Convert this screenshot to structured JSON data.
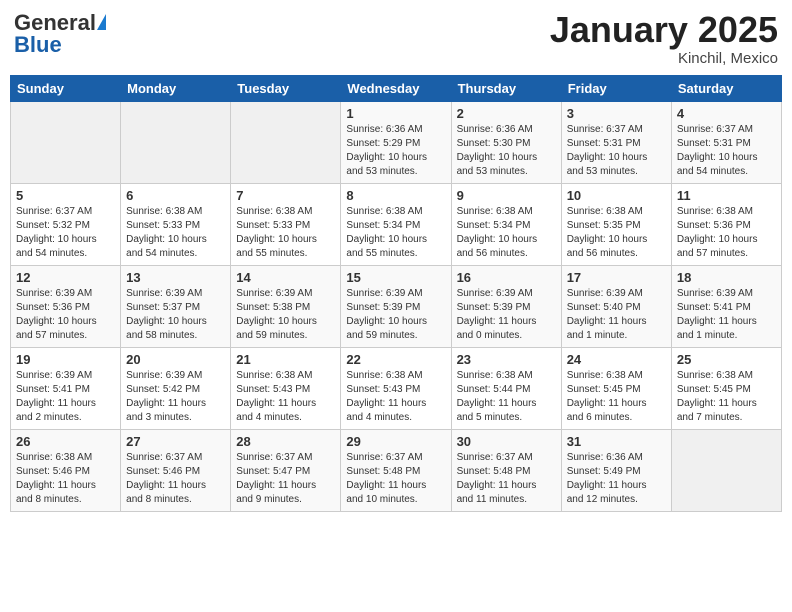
{
  "header": {
    "logo_general": "General",
    "logo_blue": "Blue",
    "month_year": "January 2025",
    "location": "Kinchil, Mexico"
  },
  "days_of_week": [
    "Sunday",
    "Monday",
    "Tuesday",
    "Wednesday",
    "Thursday",
    "Friday",
    "Saturday"
  ],
  "weeks": [
    [
      {
        "day": "",
        "info": ""
      },
      {
        "day": "",
        "info": ""
      },
      {
        "day": "",
        "info": ""
      },
      {
        "day": "1",
        "info": "Sunrise: 6:36 AM\nSunset: 5:29 PM\nDaylight: 10 hours\nand 53 minutes."
      },
      {
        "day": "2",
        "info": "Sunrise: 6:36 AM\nSunset: 5:30 PM\nDaylight: 10 hours\nand 53 minutes."
      },
      {
        "day": "3",
        "info": "Sunrise: 6:37 AM\nSunset: 5:31 PM\nDaylight: 10 hours\nand 53 minutes."
      },
      {
        "day": "4",
        "info": "Sunrise: 6:37 AM\nSunset: 5:31 PM\nDaylight: 10 hours\nand 54 minutes."
      }
    ],
    [
      {
        "day": "5",
        "info": "Sunrise: 6:37 AM\nSunset: 5:32 PM\nDaylight: 10 hours\nand 54 minutes."
      },
      {
        "day": "6",
        "info": "Sunrise: 6:38 AM\nSunset: 5:33 PM\nDaylight: 10 hours\nand 54 minutes."
      },
      {
        "day": "7",
        "info": "Sunrise: 6:38 AM\nSunset: 5:33 PM\nDaylight: 10 hours\nand 55 minutes."
      },
      {
        "day": "8",
        "info": "Sunrise: 6:38 AM\nSunset: 5:34 PM\nDaylight: 10 hours\nand 55 minutes."
      },
      {
        "day": "9",
        "info": "Sunrise: 6:38 AM\nSunset: 5:34 PM\nDaylight: 10 hours\nand 56 minutes."
      },
      {
        "day": "10",
        "info": "Sunrise: 6:38 AM\nSunset: 5:35 PM\nDaylight: 10 hours\nand 56 minutes."
      },
      {
        "day": "11",
        "info": "Sunrise: 6:38 AM\nSunset: 5:36 PM\nDaylight: 10 hours\nand 57 minutes."
      }
    ],
    [
      {
        "day": "12",
        "info": "Sunrise: 6:39 AM\nSunset: 5:36 PM\nDaylight: 10 hours\nand 57 minutes."
      },
      {
        "day": "13",
        "info": "Sunrise: 6:39 AM\nSunset: 5:37 PM\nDaylight: 10 hours\nand 58 minutes."
      },
      {
        "day": "14",
        "info": "Sunrise: 6:39 AM\nSunset: 5:38 PM\nDaylight: 10 hours\nand 59 minutes."
      },
      {
        "day": "15",
        "info": "Sunrise: 6:39 AM\nSunset: 5:39 PM\nDaylight: 10 hours\nand 59 minutes."
      },
      {
        "day": "16",
        "info": "Sunrise: 6:39 AM\nSunset: 5:39 PM\nDaylight: 11 hours\nand 0 minutes."
      },
      {
        "day": "17",
        "info": "Sunrise: 6:39 AM\nSunset: 5:40 PM\nDaylight: 11 hours\nand 1 minute."
      },
      {
        "day": "18",
        "info": "Sunrise: 6:39 AM\nSunset: 5:41 PM\nDaylight: 11 hours\nand 1 minute."
      }
    ],
    [
      {
        "day": "19",
        "info": "Sunrise: 6:39 AM\nSunset: 5:41 PM\nDaylight: 11 hours\nand 2 minutes."
      },
      {
        "day": "20",
        "info": "Sunrise: 6:39 AM\nSunset: 5:42 PM\nDaylight: 11 hours\nand 3 minutes."
      },
      {
        "day": "21",
        "info": "Sunrise: 6:38 AM\nSunset: 5:43 PM\nDaylight: 11 hours\nand 4 minutes."
      },
      {
        "day": "22",
        "info": "Sunrise: 6:38 AM\nSunset: 5:43 PM\nDaylight: 11 hours\nand 4 minutes."
      },
      {
        "day": "23",
        "info": "Sunrise: 6:38 AM\nSunset: 5:44 PM\nDaylight: 11 hours\nand 5 minutes."
      },
      {
        "day": "24",
        "info": "Sunrise: 6:38 AM\nSunset: 5:45 PM\nDaylight: 11 hours\nand 6 minutes."
      },
      {
        "day": "25",
        "info": "Sunrise: 6:38 AM\nSunset: 5:45 PM\nDaylight: 11 hours\nand 7 minutes."
      }
    ],
    [
      {
        "day": "26",
        "info": "Sunrise: 6:38 AM\nSunset: 5:46 PM\nDaylight: 11 hours\nand 8 minutes."
      },
      {
        "day": "27",
        "info": "Sunrise: 6:37 AM\nSunset: 5:46 PM\nDaylight: 11 hours\nand 8 minutes."
      },
      {
        "day": "28",
        "info": "Sunrise: 6:37 AM\nSunset: 5:47 PM\nDaylight: 11 hours\nand 9 minutes."
      },
      {
        "day": "29",
        "info": "Sunrise: 6:37 AM\nSunset: 5:48 PM\nDaylight: 11 hours\nand 10 minutes."
      },
      {
        "day": "30",
        "info": "Sunrise: 6:37 AM\nSunset: 5:48 PM\nDaylight: 11 hours\nand 11 minutes."
      },
      {
        "day": "31",
        "info": "Sunrise: 6:36 AM\nSunset: 5:49 PM\nDaylight: 11 hours\nand 12 minutes."
      },
      {
        "day": "",
        "info": ""
      }
    ]
  ]
}
